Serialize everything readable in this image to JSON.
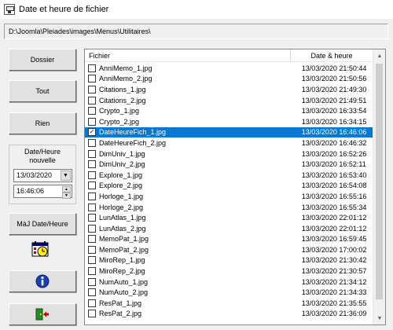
{
  "window": {
    "title": "Date et heure de fichier"
  },
  "path": "D:\\Joomla\\Pleiades\\images\\Menus\\Utilitaires\\",
  "buttons": {
    "dossier": "Dossier",
    "tout": "Tout",
    "rien": "Rien",
    "maj": "MàJ Date/Heure"
  },
  "group": {
    "label_line1": "Date/Heure",
    "label_line2": "nouvelle",
    "date_value": "13/03/2020",
    "time_value": "16:46:06"
  },
  "icons": {
    "calendar": "calendar-clock-icon",
    "info": "info-icon",
    "exit": "exit-door-icon"
  },
  "list": {
    "columns": [
      "Fichier",
      "Date & heure"
    ],
    "rows": [
      {
        "name": "AnniMemo_1.jpg",
        "date": "13/03/2020 21:50:44",
        "checked": false,
        "selected": false
      },
      {
        "name": "AnniMemo_2.jpg",
        "date": "13/03/2020 21:50:56",
        "checked": false,
        "selected": false
      },
      {
        "name": "Citations_1.jpg",
        "date": "13/03/2020 21:49:30",
        "checked": false,
        "selected": false
      },
      {
        "name": "Citations_2.jpg",
        "date": "13/03/2020 21:49:51",
        "checked": false,
        "selected": false
      },
      {
        "name": "Crypto_1.jpg",
        "date": "13/03/2020 16:33:54",
        "checked": false,
        "selected": false
      },
      {
        "name": "Crypto_2.jpg",
        "date": "13/03/2020 16:34:15",
        "checked": false,
        "selected": false
      },
      {
        "name": "DateHeureFich_1.jpg",
        "date": "13/03/2020 16:46:06",
        "checked": true,
        "selected": true
      },
      {
        "name": "DateHeureFich_2.jpg",
        "date": "13/03/2020 16:46:32",
        "checked": false,
        "selected": false
      },
      {
        "name": "DimUniv_1.jpg",
        "date": "13/03/2020 16:52:26",
        "checked": false,
        "selected": false
      },
      {
        "name": "DimUniv_2.jpg",
        "date": "13/03/2020 16:52:11",
        "checked": false,
        "selected": false
      },
      {
        "name": "Explore_1.jpg",
        "date": "13/03/2020 16:53:40",
        "checked": false,
        "selected": false
      },
      {
        "name": "Explore_2.jpg",
        "date": "13/03/2020 16:54:08",
        "checked": false,
        "selected": false
      },
      {
        "name": "Horloge_1.jpg",
        "date": "13/03/2020 16:55:16",
        "checked": false,
        "selected": false
      },
      {
        "name": "Horloge_2.jpg",
        "date": "13/03/2020 16:55:34",
        "checked": false,
        "selected": false
      },
      {
        "name": "LunAtlas_1.jpg",
        "date": "13/03/2020 22:01:12",
        "checked": false,
        "selected": false
      },
      {
        "name": "LunAtlas_2.jpg",
        "date": "13/03/2020 22:01:12",
        "checked": false,
        "selected": false
      },
      {
        "name": "MemoPat_1.jpg",
        "date": "13/03/2020 16:59:45",
        "checked": false,
        "selected": false
      },
      {
        "name": "MemoPat_2.jpg",
        "date": "13/03/2020 17:00:02",
        "checked": false,
        "selected": false
      },
      {
        "name": "MiroRep_1.jpg",
        "date": "13/03/2020 21:30:42",
        "checked": false,
        "selected": false
      },
      {
        "name": "MiroRep_2.jpg",
        "date": "13/03/2020 21:30:57",
        "checked": false,
        "selected": false
      },
      {
        "name": "NumAuto_1.jpg",
        "date": "13/03/2020 21:34:12",
        "checked": false,
        "selected": false
      },
      {
        "name": "NumAuto_2.jpg",
        "date": "13/03/2020 21:34:33",
        "checked": false,
        "selected": false
      },
      {
        "name": "ResPat_1.jpg",
        "date": "13/03/2020 21:35:55",
        "checked": false,
        "selected": false
      },
      {
        "name": "ResPat_2.jpg",
        "date": "13/03/2020 21:36:09",
        "checked": false,
        "selected": false
      }
    ]
  },
  "colors": {
    "selection": "#0078d7",
    "window_bg": "#f0f0f0"
  }
}
